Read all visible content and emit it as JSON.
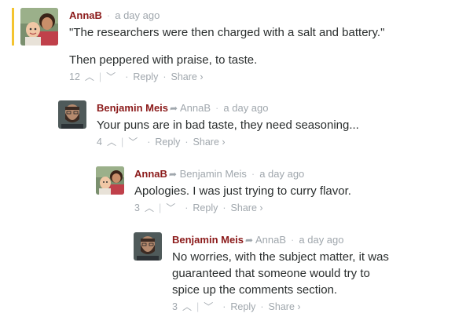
{
  "comments": [
    {
      "author": "AnnaB",
      "reply_to": "",
      "time": "a day ago",
      "paragraphs": [
        "\"The researchers were then charged with a salt and battery.\"",
        "Then peppered with praise, to taste."
      ],
      "votes": "12",
      "reply_label": "Reply",
      "share_label": "Share ›",
      "avatar": "woman-with-baby-avatar"
    },
    {
      "author": "Benjamin Meis",
      "reply_to": "AnnaB",
      "time": "a day ago",
      "paragraphs": [
        "Your puns are in bad taste, they need seasoning..."
      ],
      "votes": "4",
      "reply_label": "Reply",
      "share_label": "Share ›",
      "avatar": "bearded-man-avatar"
    },
    {
      "author": "AnnaB",
      "reply_to": "Benjamin Meis",
      "time": "a day ago",
      "paragraphs": [
        "Apologies. I was just trying to curry flavor."
      ],
      "votes": "3",
      "reply_label": "Reply",
      "share_label": "Share ›",
      "avatar": "woman-with-baby-avatar"
    },
    {
      "author": "Benjamin Meis",
      "reply_to": "AnnaB",
      "time": "a day ago",
      "paragraphs": [
        "No worries, with the subject matter, it was guaranteed that someone would try to spice up the comments section."
      ],
      "votes": "3",
      "reply_label": "Reply",
      "share_label": "Share ›",
      "avatar": "bearded-man-avatar"
    }
  ],
  "colors": {
    "author": "#8b1a1a",
    "meta": "#a0a7ad",
    "highlight": "#f4c430",
    "text": "#2a2e2e"
  }
}
